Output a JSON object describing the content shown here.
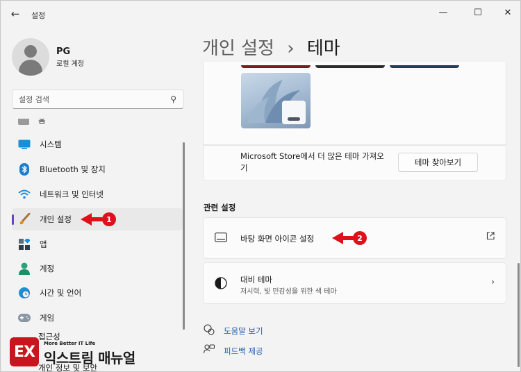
{
  "window": {
    "title": "설정",
    "back_icon": "arrow-left-icon",
    "controls": {
      "minimize": "—",
      "maximize": "☐",
      "close": "✕"
    }
  },
  "user": {
    "name": "PG",
    "account_type": "로컬 계정"
  },
  "search": {
    "placeholder": "설정 검색",
    "icon": "search-icon"
  },
  "sidebar": {
    "partial_top_label": "홈",
    "items": [
      {
        "label": "시스템",
        "icon": "system-monitor-icon",
        "selected": false
      },
      {
        "label": "Bluetooth 및 장치",
        "icon": "bluetooth-icon",
        "selected": false
      },
      {
        "label": "네트워크 및 인터넷",
        "icon": "wifi-icon",
        "selected": false
      },
      {
        "label": "개인 설정",
        "icon": "brush-icon",
        "selected": true
      },
      {
        "label": "앱",
        "icon": "apps-icon",
        "selected": false
      },
      {
        "label": "계정",
        "icon": "person-icon",
        "selected": false
      },
      {
        "label": "시간 및 언어",
        "icon": "clock-globe-icon",
        "selected": false
      },
      {
        "label": "게임",
        "icon": "gamepad-icon",
        "selected": false
      }
    ],
    "partial_bottom_labels": [
      "접근성",
      "개인 정보 및 보안"
    ],
    "accent_color": "#6842c4"
  },
  "annotations": [
    {
      "number": "1",
      "color": "#e0101a"
    },
    {
      "number": "2",
      "color": "#e0101a"
    }
  ],
  "main": {
    "breadcrumb_parent": "개인 설정",
    "breadcrumb_separator": "›",
    "breadcrumb_current": "테마",
    "theme_strip_colors": [
      "#7a1b1f",
      "#2b2b2b",
      "#1e3f55"
    ],
    "store_text": "Microsoft Store에서 더 많은 테마 가져오기",
    "store_button": "테마 찾아보기",
    "related_title": "관련 설정",
    "cards": [
      {
        "title": "바탕 화면 아이콘 설정",
        "subtitle": "",
        "icon": "desktop-icon",
        "end_icon": "open-external-icon"
      },
      {
        "title": "대비 테마",
        "subtitle": "저시력, 빛 민감성을 위한 색 테마",
        "icon": "contrast-icon",
        "end_icon": "chevron-right-icon"
      }
    ],
    "help_links": [
      {
        "label": "도움말 보기",
        "icon": "help-icon"
      },
      {
        "label": "피드백 제공",
        "icon": "feedback-icon"
      }
    ]
  },
  "watermark": {
    "logo_text": "EX",
    "tagline": "More Better IT Life",
    "name": "익스트림 매뉴얼"
  }
}
